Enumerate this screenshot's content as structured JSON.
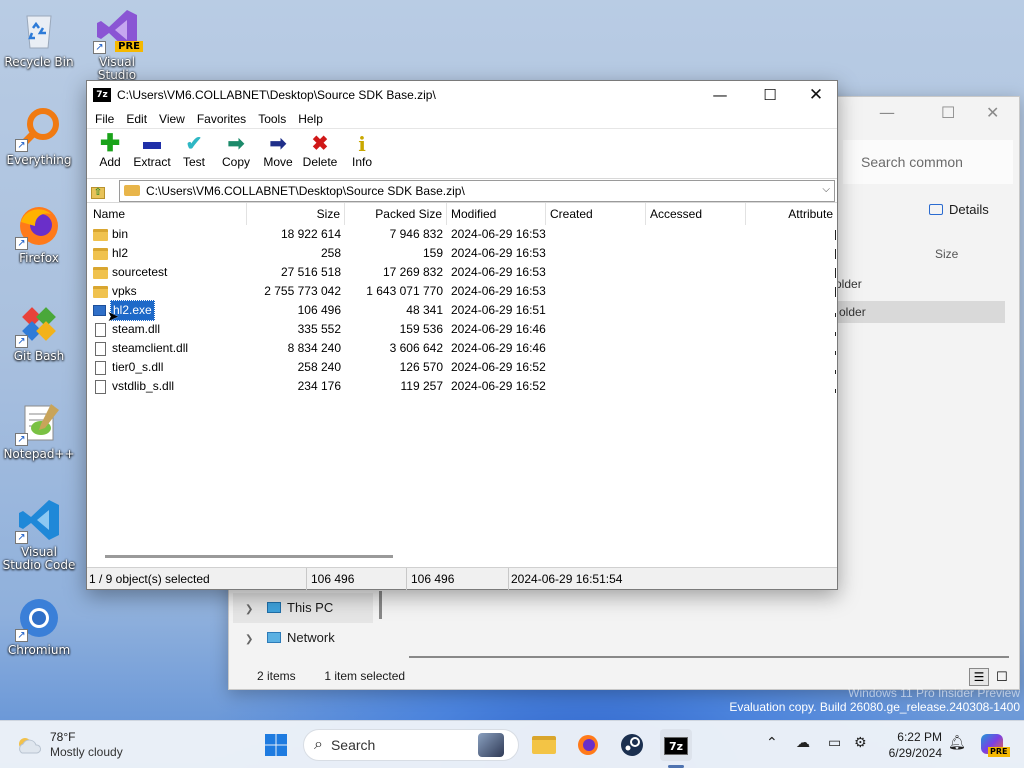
{
  "desktop": {
    "icons": [
      {
        "label": "Recycle Bin"
      },
      {
        "label": "Visual Studio",
        "badge": "PRE"
      },
      {
        "label": "Everything"
      },
      {
        "label": "Firefox"
      },
      {
        "label": "Git Bash"
      },
      {
        "label": "Notepad++"
      },
      {
        "label": "Visual Studio Code"
      },
      {
        "label": "Chromium"
      }
    ]
  },
  "explorer": {
    "search_placeholder": "Search common",
    "details_label": "Details",
    "size_col": "Size",
    "row1_text": "older",
    "row2_text": "older",
    "nav": [
      {
        "label": "This PC"
      },
      {
        "label": "Network"
      }
    ],
    "status_items": "2 items",
    "status_selected": "1 item selected"
  },
  "sevenzip": {
    "title": "C:\\Users\\VM6.COLLABNET\\Desktop\\Source SDK Base.zip\\",
    "app_badge": "7z",
    "menu": [
      "File",
      "Edit",
      "View",
      "Favorites",
      "Tools",
      "Help"
    ],
    "toolbar": [
      {
        "label": "Add",
        "icon": "plus-icon",
        "color": "#1aa31a"
      },
      {
        "label": "Extract",
        "icon": "minus-icon",
        "color": "#1f2fa8"
      },
      {
        "label": "Test",
        "icon": "check-icon",
        "color": "#2fb7c4"
      },
      {
        "label": "Copy",
        "icon": "copy-arrow-icon",
        "color": "#1b8a6a"
      },
      {
        "label": "Move",
        "icon": "move-arrow-icon",
        "color": "#1f2f8a"
      },
      {
        "label": "Delete",
        "icon": "x-icon",
        "color": "#d01818"
      },
      {
        "label": "Info",
        "icon": "info-icon",
        "color": "#c9a800"
      }
    ],
    "address": "C:\\Users\\VM6.COLLABNET\\Desktop\\Source SDK Base.zip\\",
    "columns": [
      "Name",
      "Size",
      "Packed Size",
      "Modified",
      "Created",
      "Accessed",
      "Attribute"
    ],
    "files": [
      {
        "name": "bin",
        "type": "folder",
        "size": "18 922 614",
        "packed": "7 946 832",
        "modified": "2024-06-29 16:53"
      },
      {
        "name": "hl2",
        "type": "folder",
        "size": "258",
        "packed": "159",
        "modified": "2024-06-29 16:53"
      },
      {
        "name": "sourcetest",
        "type": "folder",
        "size": "27 516 518",
        "packed": "17 269 832",
        "modified": "2024-06-29 16:53"
      },
      {
        "name": "vpks",
        "type": "folder",
        "size": "2 755 773 042",
        "packed": "1 643 071 770",
        "modified": "2024-06-29 16:53"
      },
      {
        "name": "hl2.exe",
        "type": "exe",
        "size": "106 496",
        "packed": "48 341",
        "modified": "2024-06-29 16:51",
        "selected": true
      },
      {
        "name": "steam.dll",
        "type": "file",
        "size": "335 552",
        "packed": "159 536",
        "modified": "2024-06-29 16:46"
      },
      {
        "name": "steamclient.dll",
        "type": "file",
        "size": "8 834 240",
        "packed": "3 606 642",
        "modified": "2024-06-29 16:46"
      },
      {
        "name": "tier0_s.dll",
        "type": "file",
        "size": "258 240",
        "packed": "126 570",
        "modified": "2024-06-29 16:52"
      },
      {
        "name": "vstdlib_s.dll",
        "type": "file",
        "size": "234 176",
        "packed": "119 257",
        "modified": "2024-06-29 16:52"
      }
    ],
    "status": {
      "selection": "1 / 9 object(s) selected",
      "size": "106 496",
      "packed": "106 496",
      "modified": "2024-06-29 16:51:54"
    }
  },
  "watermark": {
    "line1": "Windows 11 Pro Insider Preview",
    "line2": "Evaluation copy. Build 26080.ge_release.240308-1400"
  },
  "taskbar": {
    "weather_temp": "78°F",
    "weather_desc": "Mostly cloudy",
    "search_label": "Search",
    "time": "6:22 PM",
    "date": "6/29/2024",
    "copilot_badge": "PRE"
  }
}
